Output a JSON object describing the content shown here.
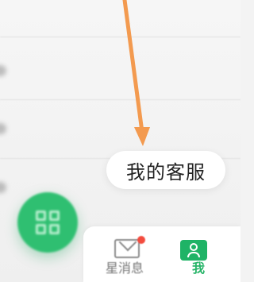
{
  "tooltip": {
    "text": "我的客服"
  },
  "floating_button": {
    "icon": "qr-code-icon"
  },
  "bottom_nav": {
    "items": [
      {
        "label": "星消息",
        "icon": "mail-icon",
        "has_badge": true
      },
      {
        "label": "我",
        "icon": "user-profile-icon",
        "active": true
      }
    ]
  },
  "colors": {
    "accent_green": "#27b468",
    "arrow_orange": "#f39a4f",
    "badge_red": "#f34b3e",
    "tooltip_bg": "#ffffff"
  }
}
